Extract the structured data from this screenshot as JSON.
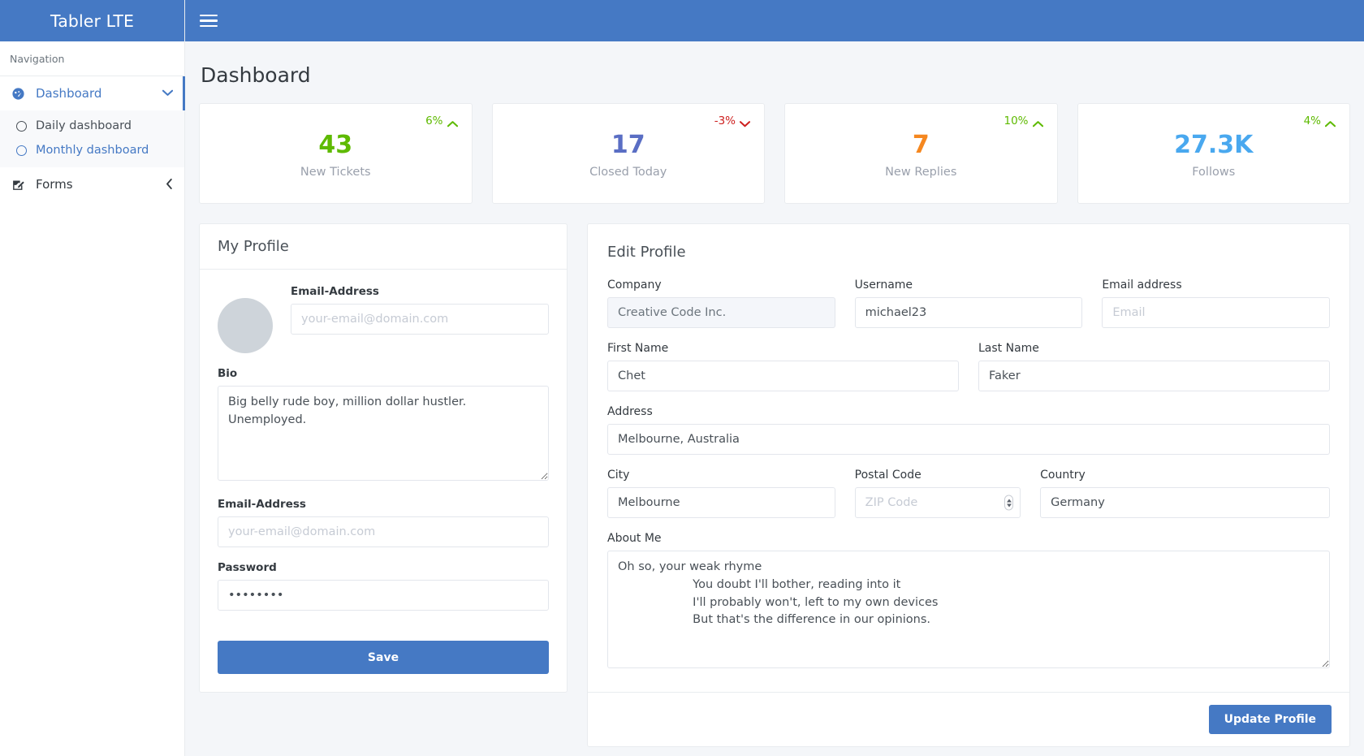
{
  "brand": {
    "title": "Tabler LTE"
  },
  "sidebar": {
    "nav_header": "Navigation",
    "items": [
      {
        "label": "Dashboard",
        "icon": "dashboard-gauge-icon",
        "arrow": "chevron-down-icon",
        "active": true
      },
      {
        "label": "Forms",
        "icon": "edit-square-icon",
        "arrow": "chevron-left-icon",
        "active": false
      }
    ],
    "subitems": [
      {
        "label": "Daily dashboard",
        "icon": "circle-icon",
        "active": false
      },
      {
        "label": "Monthly dashboard",
        "icon": "circle-icon",
        "active": true
      }
    ]
  },
  "topbar": {
    "menu_icon": "hamburger-icon"
  },
  "page": {
    "title": "Dashboard"
  },
  "stats": [
    {
      "value": "43",
      "label": "New Tickets",
      "trend": "6%",
      "direction": "up",
      "value_color": "#5eba00",
      "trend_color": "#5eba00"
    },
    {
      "value": "17",
      "label": "Closed Today",
      "trend": "-3%",
      "direction": "down",
      "value_color": "#5a6ec4",
      "trend_color": "#cd201f"
    },
    {
      "value": "7",
      "label": "New Replies",
      "trend": "10%",
      "direction": "up",
      "value_color": "#f5871f",
      "trend_color": "#5eba00"
    },
    {
      "value": "27.3K",
      "label": "Follows",
      "trend": "4%",
      "direction": "up",
      "value_color": "#49a8ef",
      "trend_color": "#5eba00"
    }
  ],
  "my_profile": {
    "title": "My Profile",
    "avatar": "user-avatar",
    "email_top": {
      "label": "Email-Address",
      "value": "",
      "placeholder": "your-email@domain.com"
    },
    "bio": {
      "label": "Bio",
      "value": "Big belly rude boy, million dollar hustler. Unemployed.",
      "placeholder": ""
    },
    "email_bottom": {
      "label": "Email-Address",
      "value": "",
      "placeholder": "your-email@domain.com"
    },
    "password": {
      "label": "Password",
      "value": "••••••••",
      "placeholder": ""
    },
    "save_label": "Save"
  },
  "edit_profile": {
    "title": "Edit Profile",
    "company": {
      "label": "Company",
      "value": "Creative Code Inc.",
      "placeholder": "",
      "disabled": true
    },
    "username": {
      "label": "Username",
      "value": "michael23",
      "placeholder": ""
    },
    "email": {
      "label": "Email address",
      "value": "",
      "placeholder": "Email"
    },
    "first_name": {
      "label": "First Name",
      "value": "Chet",
      "placeholder": ""
    },
    "last_name": {
      "label": "Last Name",
      "value": "Faker",
      "placeholder": ""
    },
    "address": {
      "label": "Address",
      "value": "Melbourne, Australia",
      "placeholder": ""
    },
    "city": {
      "label": "City",
      "value": "Melbourne",
      "placeholder": ""
    },
    "postal": {
      "label": "Postal Code",
      "value": "",
      "placeholder": "ZIP Code"
    },
    "country": {
      "label": "Country",
      "value": "Germany",
      "placeholder": ""
    },
    "about": {
      "label": "About Me",
      "value": "Oh so, your weak rhyme\n                    You doubt I'll bother, reading into it\n                    I'll probably won't, left to my own devices\n                    But that's the difference in our opinions.",
      "placeholder": ""
    },
    "update_label": "Update Profile"
  },
  "colors": {
    "brand_blue": "#4579c4",
    "success": "#5eba00",
    "danger": "#cd201f",
    "page_bg": "#f4f6f9"
  }
}
